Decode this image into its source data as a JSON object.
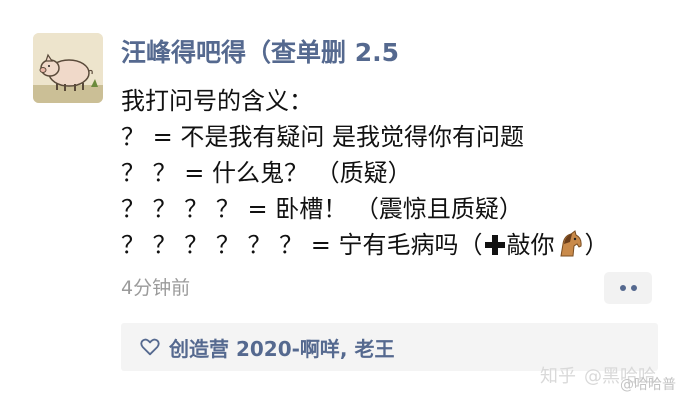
{
  "post": {
    "author": "汪峰得吧得（查单删 2.5",
    "lines": [
      "我打问号的含义：",
      "？ = 不是我有疑问 是我觉得你有问题",
      "？ ？ = 什么鬼？ （质疑）",
      "？ ？ ？ ？ = 卧槽！ （震惊且质疑）",
      "？ ？ ？ ？ ？ ？ = 宁有毛病吗（",
      "敲你",
      "）"
    ],
    "timestamp": "4分钟前"
  },
  "likes": {
    "text": "创造营 2020-啊咩, 老王"
  },
  "watermark": {
    "site": "知乎",
    "handle": "@黑哈哈",
    "handle2": "@哈哈普"
  },
  "colors": {
    "accent": "#55698f",
    "text": "#111111",
    "muted": "#9b9b9b",
    "card_bg": "#f4f4f4"
  },
  "icons": {
    "avatar": "pig-avatar",
    "more": "more-dots-icon",
    "heart": "heart-icon",
    "plus": "plus-emoji-icon",
    "horse": "horse-emoji-icon"
  }
}
